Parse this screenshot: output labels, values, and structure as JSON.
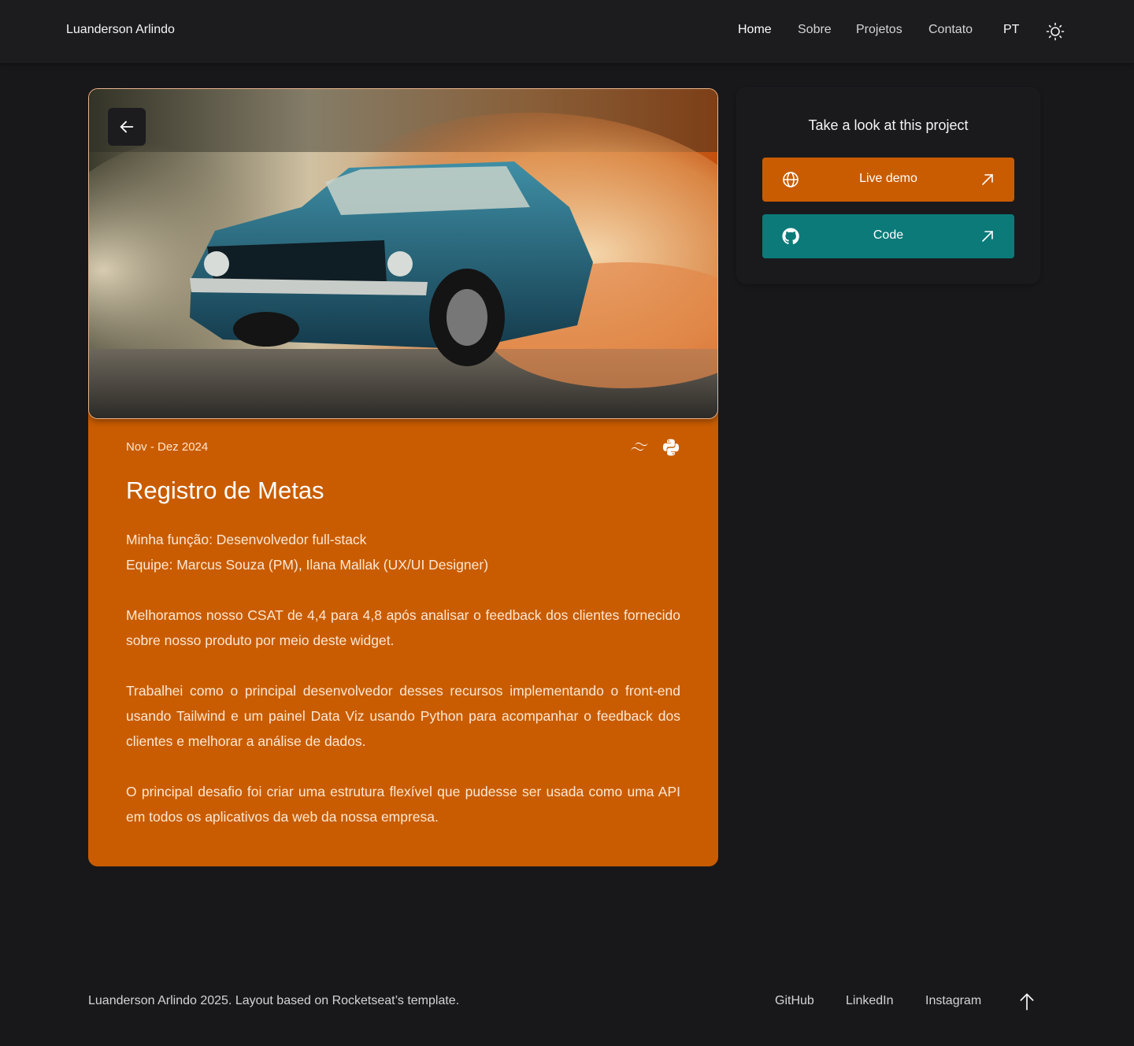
{
  "header": {
    "brand": "Luanderson Arlindo",
    "nav": [
      {
        "label": "Home",
        "active": true
      },
      {
        "label": "Sobre",
        "active": false
      },
      {
        "label": "Projetos",
        "active": false
      },
      {
        "label": "Contato",
        "active": false
      }
    ],
    "language": "PT",
    "theme_icon": "sun-icon"
  },
  "project": {
    "back_icon": "arrow-left-icon",
    "image": "muscle-car-burnout-smoke",
    "date": "Nov - Dez 2024",
    "tech_icons": [
      "tailwind-icon",
      "python-icon"
    ],
    "title": "Registro de Metas",
    "role": "Minha função: Desenvolvedor full-stack",
    "team": "Equipe: Marcus Souza (PM), Ilana Mallak (UX/UI Designer)",
    "paragraphs": [
      "Melhoramos nosso CSAT de 4,4 para 4,8 após analisar o feedback dos clientes fornecido sobre nosso produto por meio deste widget.",
      "Trabalhei como o principal desenvolvedor desses recursos implementando o front-end usando Tailwind e um painel Data Viz usando Python para acompanhar o feedback dos clientes e melhorar a análise de dados.",
      "O principal desafio foi criar uma estrutura flexível que pudesse ser usada como uma API em todos os aplicativos da web da nossa empresa."
    ]
  },
  "side_panel": {
    "title": "Take a look at this project",
    "buttons": [
      {
        "label": "Live demo",
        "icon": "globe-icon",
        "trailing_icon": "arrow-up-right-icon",
        "color": "#c95c00"
      },
      {
        "label": "Code",
        "icon": "github-icon",
        "trailing_icon": "arrow-up-right-icon",
        "color": "#0b7a79"
      }
    ]
  },
  "footer": {
    "credit": "Luanderson Arlindo 2025. Layout based on Rocketseat’s template.",
    "links": [
      "GitHub",
      "LinkedIn",
      "Instagram"
    ],
    "scroll_top_icon": "arrow-up-icon"
  },
  "colors": {
    "background": "#18181b",
    "header": "#1c1c1f",
    "accent_orange": "#c95c00",
    "accent_teal": "#0b7a79"
  }
}
